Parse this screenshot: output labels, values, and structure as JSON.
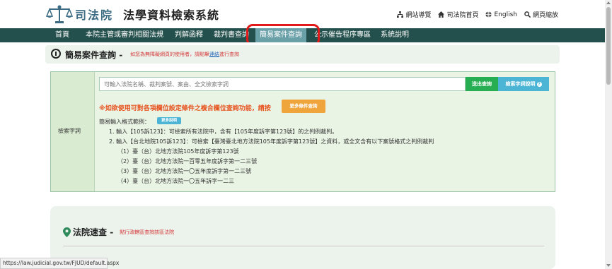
{
  "header": {
    "court_name": "司法院",
    "system_name": "法學資料檢索系統",
    "links": [
      {
        "label": "網站導覽",
        "icon": "sitemap-icon"
      },
      {
        "label": "司法院首頁",
        "icon": "home-icon"
      },
      {
        "label": "English",
        "icon": "globe-icon"
      },
      {
        "label": "網頁縮放",
        "icon": "zoom-icon"
      }
    ]
  },
  "nav": {
    "items": [
      "首頁",
      "本院主管或審判相關法規",
      "判解函釋",
      "裁判書查詢",
      "簡易案件查詢",
      "公示催告程序專區",
      "系統說明"
    ],
    "active_index": 4,
    "highlight_color": "#e11a1a"
  },
  "title_bar": {
    "title": "簡易案件查詢",
    "separator": "-",
    "hint_prefix": "如您為無障礙網頁的使用者，請點擊",
    "hint_link": "連結",
    "hint_suffix": "進行查詢"
  },
  "search": {
    "label": "檢索字詞",
    "placeholder": "可輸入法院名稱、裁判案號、案由、全文檢索字詞",
    "submit_label": "送出查詢",
    "help_label": "檢索字詞說明",
    "advanced_note": "※如欲使用可對各項欄位設定條件之複合欄位查詢功能，請按",
    "more_conditions_label": "更多條件查詢",
    "examples_label": "簡易輸入格式範例：",
    "more_desc_label": "更多說明",
    "examples": [
      "1. 輸入【105訴123】：可檢索所有法院中，含有【105年度訴字第123號】的之判例裁判。",
      "2. 輸入【台北地院105訴123】：可檢索【臺灣臺北地方法院105年度訴字第123號】之資料，或全文含有以下案號格式之判例裁判",
      "（1）臺（台）北地方法院105年度訴字第123號",
      "（2）臺（台）北地方法院一百零五年度訴字第一二三號",
      "（3）臺（台）北地方法院一〇五年度訴字第一二三號",
      "（4）臺（台）北地方法院一〇五年訴字一二三"
    ]
  },
  "court_lookup": {
    "title": "法院速查",
    "separator": "-",
    "subtitle": "點行政轄區查詢該區法院"
  },
  "status_url": "https://law.judicial.gov.tw/FJUD/default.aspx"
}
